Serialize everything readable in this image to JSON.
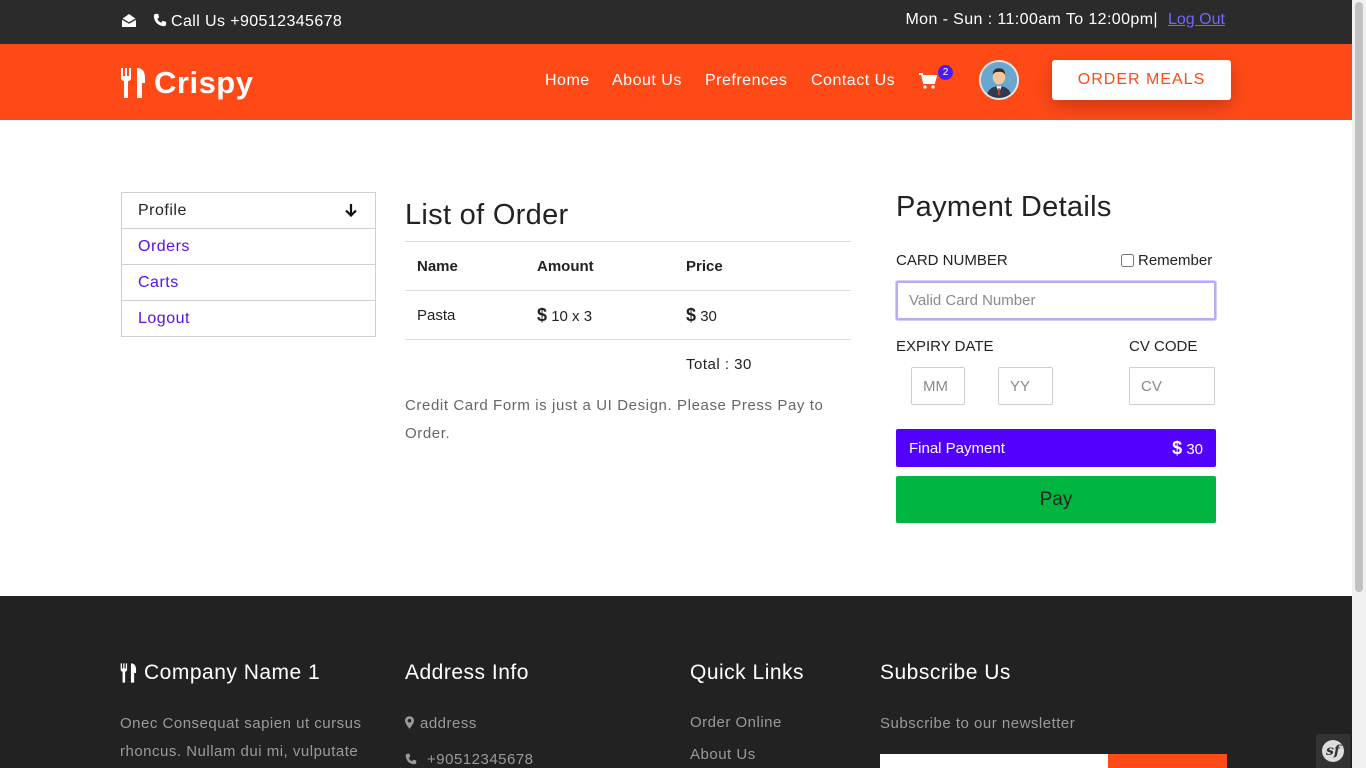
{
  "topbar": {
    "call_text": "Call Us +90512345678",
    "hours_text": "Mon - Sun : 11:00am To 12:00pm|",
    "logout_label": "Log Out"
  },
  "navbar": {
    "brand": "Crispy",
    "links": [
      "Home",
      "About Us",
      "Prefrences",
      "Contact Us"
    ],
    "cart_count": "2",
    "order_button": "ORDER MEALS"
  },
  "sidemenu": {
    "items": [
      "Profile",
      "Orders",
      "Carts",
      "Logout"
    ]
  },
  "orders": {
    "title": "List of Order",
    "headers": [
      "Name",
      "Amount",
      "Price"
    ],
    "rows": [
      {
        "name": "Pasta",
        "amount_symbol": "$",
        "amount": "10 x 3",
        "price_symbol": "$",
        "price": "30"
      }
    ],
    "total_text": "Total : 30",
    "note": "Credit Card Form is just a UI Design. Please Press Pay to Order."
  },
  "payment": {
    "title": "Payment Details",
    "card_label": "CARD NUMBER",
    "remember_label": "Remember",
    "card_placeholder": "Valid Card Number",
    "expiry_label": "EXPIRY DATE",
    "cv_label": "CV CODE",
    "mm_placeholder": "MM",
    "yy_placeholder": "YY",
    "cv_placeholder": "CV",
    "final_label": "Final Payment",
    "final_symbol": "$",
    "final_amount": "30",
    "pay_label": "Pay"
  },
  "footer": {
    "company_title": "Company Name 1",
    "company_text": "Onec Consequat sapien ut cursus rhoncus. Nullam dui mi, vulputate",
    "address_title": "Address Info",
    "address": "address",
    "phone": "+90512345678",
    "links_title": "Quick Links",
    "links": [
      "Order Online",
      "About Us"
    ],
    "subscribe_title": "Subscribe Us",
    "subscribe_text": "Subscribe to our newsletter"
  },
  "colors": {
    "brand_orange": "#ff4a17",
    "accent_purple": "#5200ff",
    "pay_green": "#00b640",
    "topbar_dark": "#2b2b2b",
    "footer_dark": "#222222"
  },
  "icons": [
    "envelope-open-icon",
    "phone-icon",
    "cutlery-icon",
    "cart-icon",
    "arrow-down-icon",
    "map-marker-icon",
    "symfony-icon"
  ]
}
